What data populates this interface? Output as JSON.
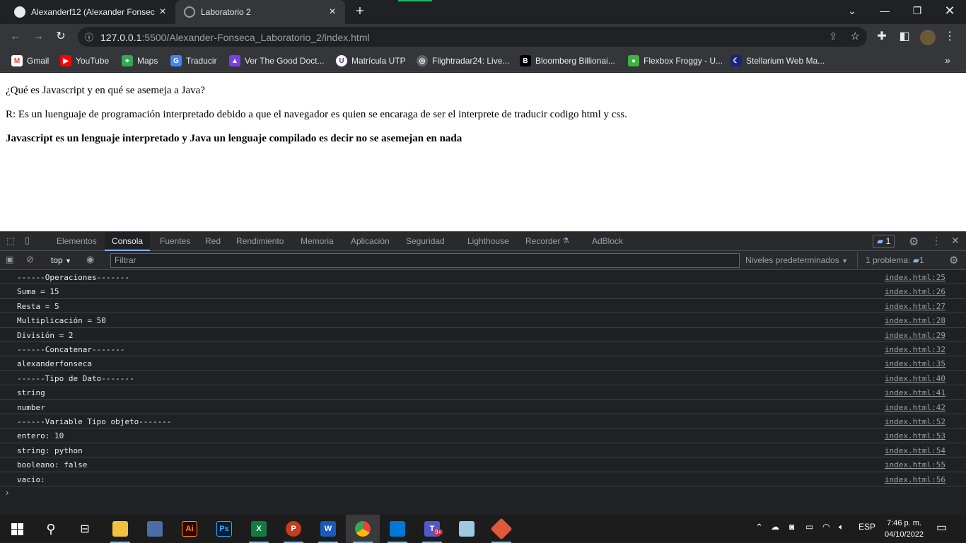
{
  "browser": {
    "tabs": [
      {
        "title": "Alexanderf12 (Alexander Fonseca"
      },
      {
        "title": "Laboratorio 2"
      }
    ],
    "url": {
      "host": "127.0.0.1",
      "rest": ":5500/Alexander-Fonseca_Laboratorio_2/index.html"
    },
    "bookmarks": [
      {
        "label": "Gmail"
      },
      {
        "label": "YouTube"
      },
      {
        "label": "Maps"
      },
      {
        "label": "Traducir"
      },
      {
        "label": "Ver The Good Doct..."
      },
      {
        "label": "Matrícula UTP"
      },
      {
        "label": "Flightradar24: Live..."
      },
      {
        "label": "Bloomberg Billionai..."
      },
      {
        "label": "Flexbox Froggy - U..."
      },
      {
        "label": "Stellarium Web Ma..."
      }
    ]
  },
  "page": {
    "question": "¿Qué es Javascript y en qué se asemeja a Java?",
    "answer": "R: Es un luenguaje de programación interpretado debido a que el navegador es quien se encaraga de ser el interprete de traducir codigo html y css.",
    "bold": "Javascript es un lenguaje interpretado y Java un lenguaje compilado es decir no se asemejan en nada"
  },
  "devtools": {
    "tabs": [
      "Elementos",
      "Consola",
      "Fuentes",
      "Red",
      "Rendimiento",
      "Memoria",
      "Aplicación",
      "Seguridad",
      "Lighthouse",
      "Recorder",
      "AdBlock"
    ],
    "issues_count": "1",
    "context": "top",
    "filter_placeholder": "Filtrar",
    "levels": "Niveles predeterminados",
    "problems": "1 problema:",
    "problems_count": "1",
    "console_rows": [
      {
        "msg": "------Operaciones-------",
        "src": "index.html:25"
      },
      {
        "msg": "Suma = 15",
        "src": "index.html:26"
      },
      {
        "msg": "Resta = 5",
        "src": "index.html:27"
      },
      {
        "msg": "Multiplicación = 50",
        "src": "index.html:28"
      },
      {
        "msg": "División = 2",
        "src": "index.html:29"
      },
      {
        "msg": "------Concatenar-------",
        "src": "index.html:32"
      },
      {
        "msg": "alexanderfonseca",
        "src": "index.html:35"
      },
      {
        "msg": "------Tipo de Dato-------",
        "src": "index.html:40"
      },
      {
        "msg": "string",
        "src": "index.html:41"
      },
      {
        "msg": "number",
        "src": "index.html:42"
      },
      {
        "msg": "------Variable Tipo objeto-------",
        "src": "index.html:52"
      },
      {
        "msg": "entero: 10",
        "src": "index.html:53"
      },
      {
        "msg": "string: python",
        "src": "index.html:54"
      },
      {
        "msg": "booleano: false",
        "src": "index.html:55"
      },
      {
        "msg": "vacio:",
        "src": "index.html:56"
      }
    ]
  },
  "taskbar": {
    "apps": [
      {
        "name": "file-explorer",
        "label": ""
      },
      {
        "name": "calculator",
        "label": ""
      },
      {
        "name": "illustrator",
        "label": "Ai"
      },
      {
        "name": "photoshop",
        "label": "Ps"
      },
      {
        "name": "excel",
        "label": "X"
      },
      {
        "name": "powerpoint",
        "label": "P"
      },
      {
        "name": "word",
        "label": "W"
      },
      {
        "name": "chrome",
        "label": ""
      },
      {
        "name": "vscode",
        "label": ""
      },
      {
        "name": "teams",
        "label": "T"
      },
      {
        "name": "notes",
        "label": ""
      },
      {
        "name": "git",
        "label": ""
      }
    ],
    "teams_badge": "9+",
    "lang": "ESP",
    "time": "7:46 p. m.",
    "date": "04/10/2022"
  },
  "colors": {
    "accent": "#8ab4f8",
    "chrome_active": "#35363a",
    "taskbar": "#1c1c1c"
  }
}
